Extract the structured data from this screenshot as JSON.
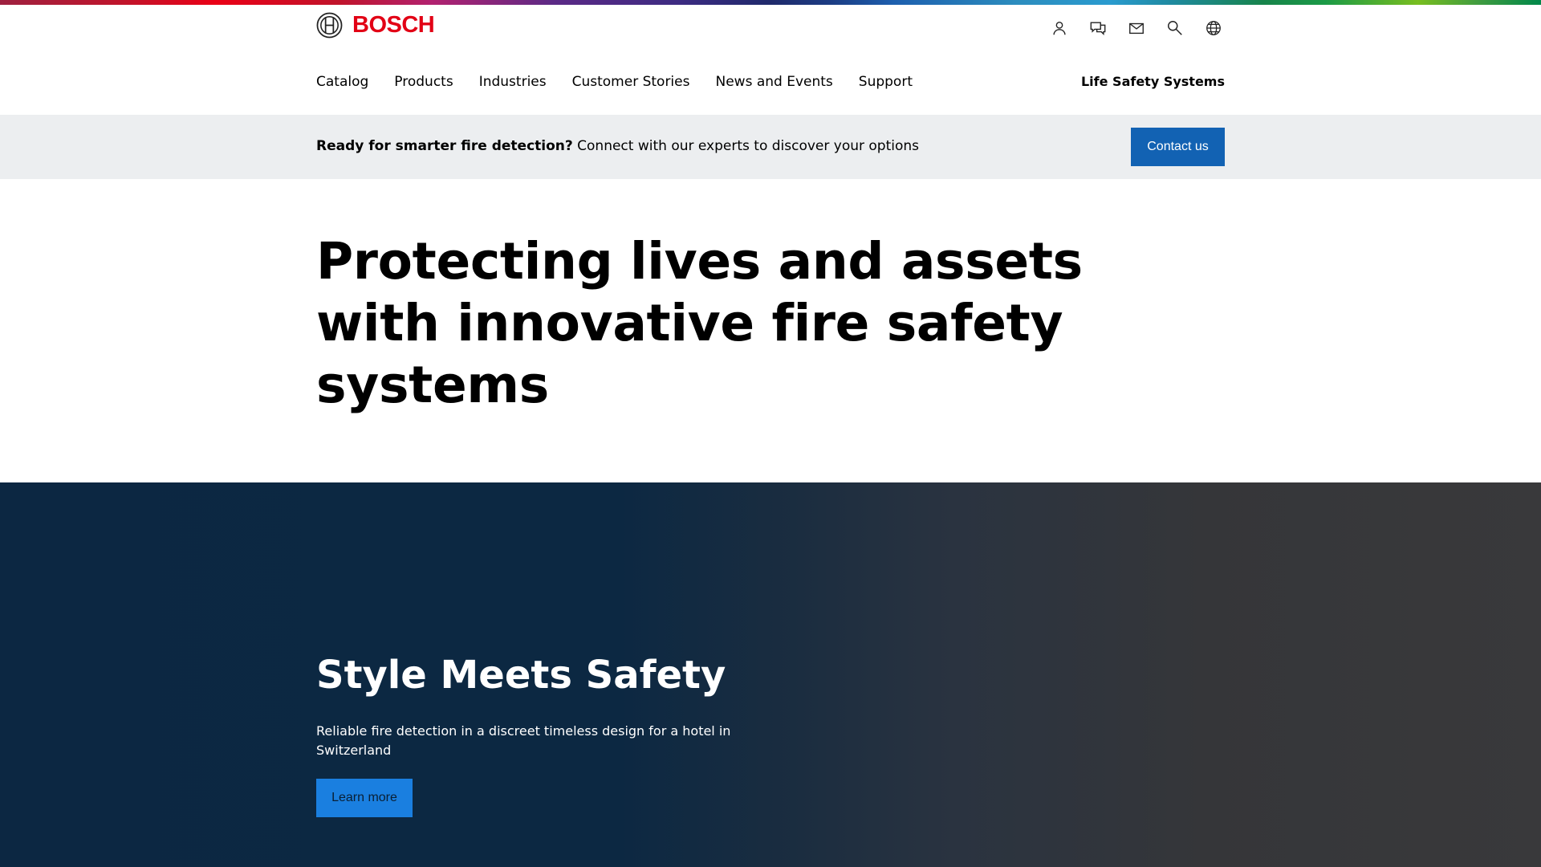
{
  "brand": {
    "name": "BOSCH",
    "logo_icon": "bosch-armature-icon",
    "color": "#e20015"
  },
  "utility_nav": [
    {
      "icon": "user-icon",
      "label": "My Bosch"
    },
    {
      "icon": "chat-icon",
      "label": "Contact"
    },
    {
      "icon": "mail-icon",
      "label": "Newsletter"
    },
    {
      "icon": "search-icon",
      "label": "Search"
    },
    {
      "icon": "globe-icon",
      "label": "Language"
    }
  ],
  "main_nav": [
    "Catalog",
    "Products",
    "Industries",
    "Customer Stories",
    "News and Events",
    "Support"
  ],
  "division": "Life Safety Systems",
  "banner": {
    "bold": "Ready for smarter fire detection?",
    "text": " Connect with our experts to discover your options",
    "button": "Contact us"
  },
  "hero": {
    "title": "Protecting lives and assets with innovative fire safety systems"
  },
  "feature": {
    "title": "Style Meets Safety",
    "description": "Reliable fire detection in a discreet timeless design for a hotel in Switzerland",
    "button": "Learn more"
  },
  "colors": {
    "primary_button": "#1262b3",
    "feature_button": "#1a7fe0",
    "banner_bg": "#eceef0",
    "feature_bg": "#0c2742"
  }
}
